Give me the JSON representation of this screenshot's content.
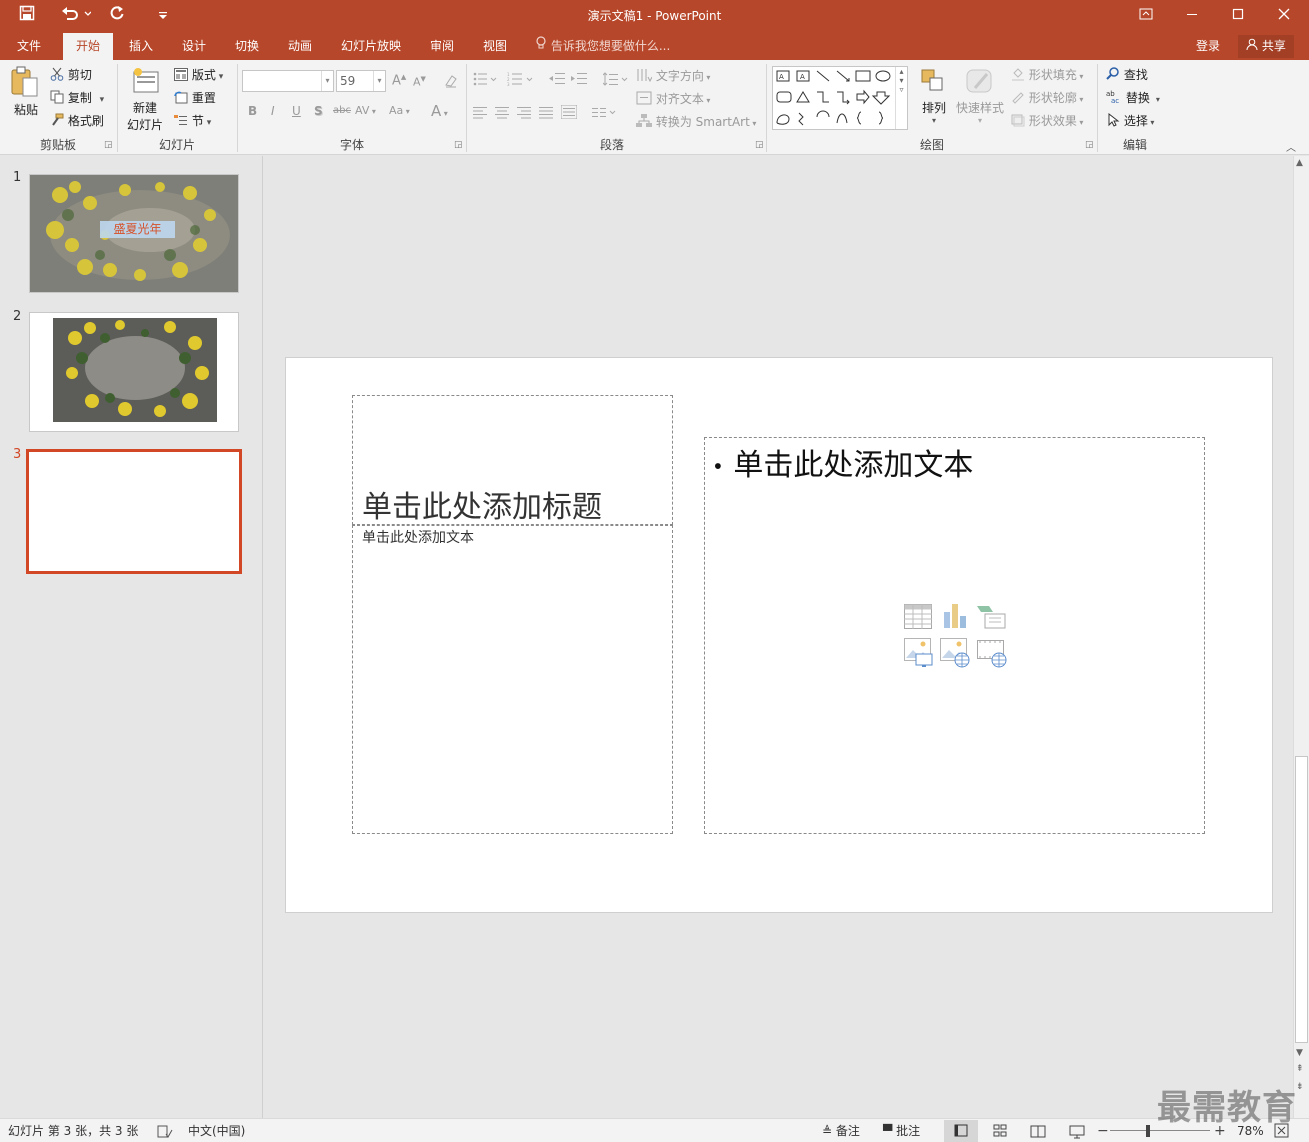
{
  "colors": {
    "accent": "#b7472a",
    "selection": "#d24726"
  },
  "titlebar": {
    "title": "演示文稿1 - PowerPoint",
    "save_icon": "save-icon",
    "undo_icon": "undo-icon",
    "redo_icon": "redo-icon",
    "customize_icon": "customize-qat-icon"
  },
  "tabs": [
    {
      "label": "文件"
    },
    {
      "label": "开始"
    },
    {
      "label": "插入"
    },
    {
      "label": "设计"
    },
    {
      "label": "切换"
    },
    {
      "label": "动画"
    },
    {
      "label": "幻灯片放映"
    },
    {
      "label": "审阅"
    },
    {
      "label": "视图"
    }
  ],
  "tellme": "告诉我您想要做什么...",
  "account": {
    "login": "登录",
    "share": "共享"
  },
  "clipboard": {
    "paste": "粘贴",
    "cut": "剪切",
    "copy": "复制",
    "format_painter": "格式刷",
    "group": "剪贴板"
  },
  "slides_group": {
    "new_slide_1": "新建",
    "new_slide_2": "幻灯片",
    "layout": "版式",
    "reset": "重置",
    "section": "节",
    "group": "幻灯片"
  },
  "font": {
    "name": "",
    "size": "59",
    "group": "字体",
    "bold": "B",
    "italic": "I",
    "underline": "U",
    "shadow": "S",
    "strike": "abc",
    "spacing": "AV",
    "case": "Aa",
    "color": "A"
  },
  "paragraph": {
    "text_direction": "文字方向",
    "align_text": "对齐文本",
    "smartart": "转换为 SmartArt",
    "group": "段落"
  },
  "drawing": {
    "arrange": "排列",
    "quick_styles": "快速样式",
    "fill": "形状填充",
    "outline": "形状轮廓",
    "effects": "形状效果",
    "group": "绘图"
  },
  "editing": {
    "find": "查找",
    "replace": "替换",
    "select": "选择",
    "group": "编辑"
  },
  "slide_thumbs": [
    {
      "num": "1",
      "caption": "盛夏光年"
    },
    {
      "num": "2"
    },
    {
      "num": "3"
    }
  ],
  "slide": {
    "title_placeholder": "单击此处添加标题",
    "text_placeholder_left": "单击此处添加文本",
    "content_placeholder": "单击此处添加文本",
    "bullet": "•"
  },
  "status": {
    "slide_info": "幻灯片 第 3 张，共 3 张",
    "language": "中文(中国)",
    "notes": "备注",
    "comments": "批注",
    "zoom": "78%"
  },
  "watermark": "最需教育"
}
